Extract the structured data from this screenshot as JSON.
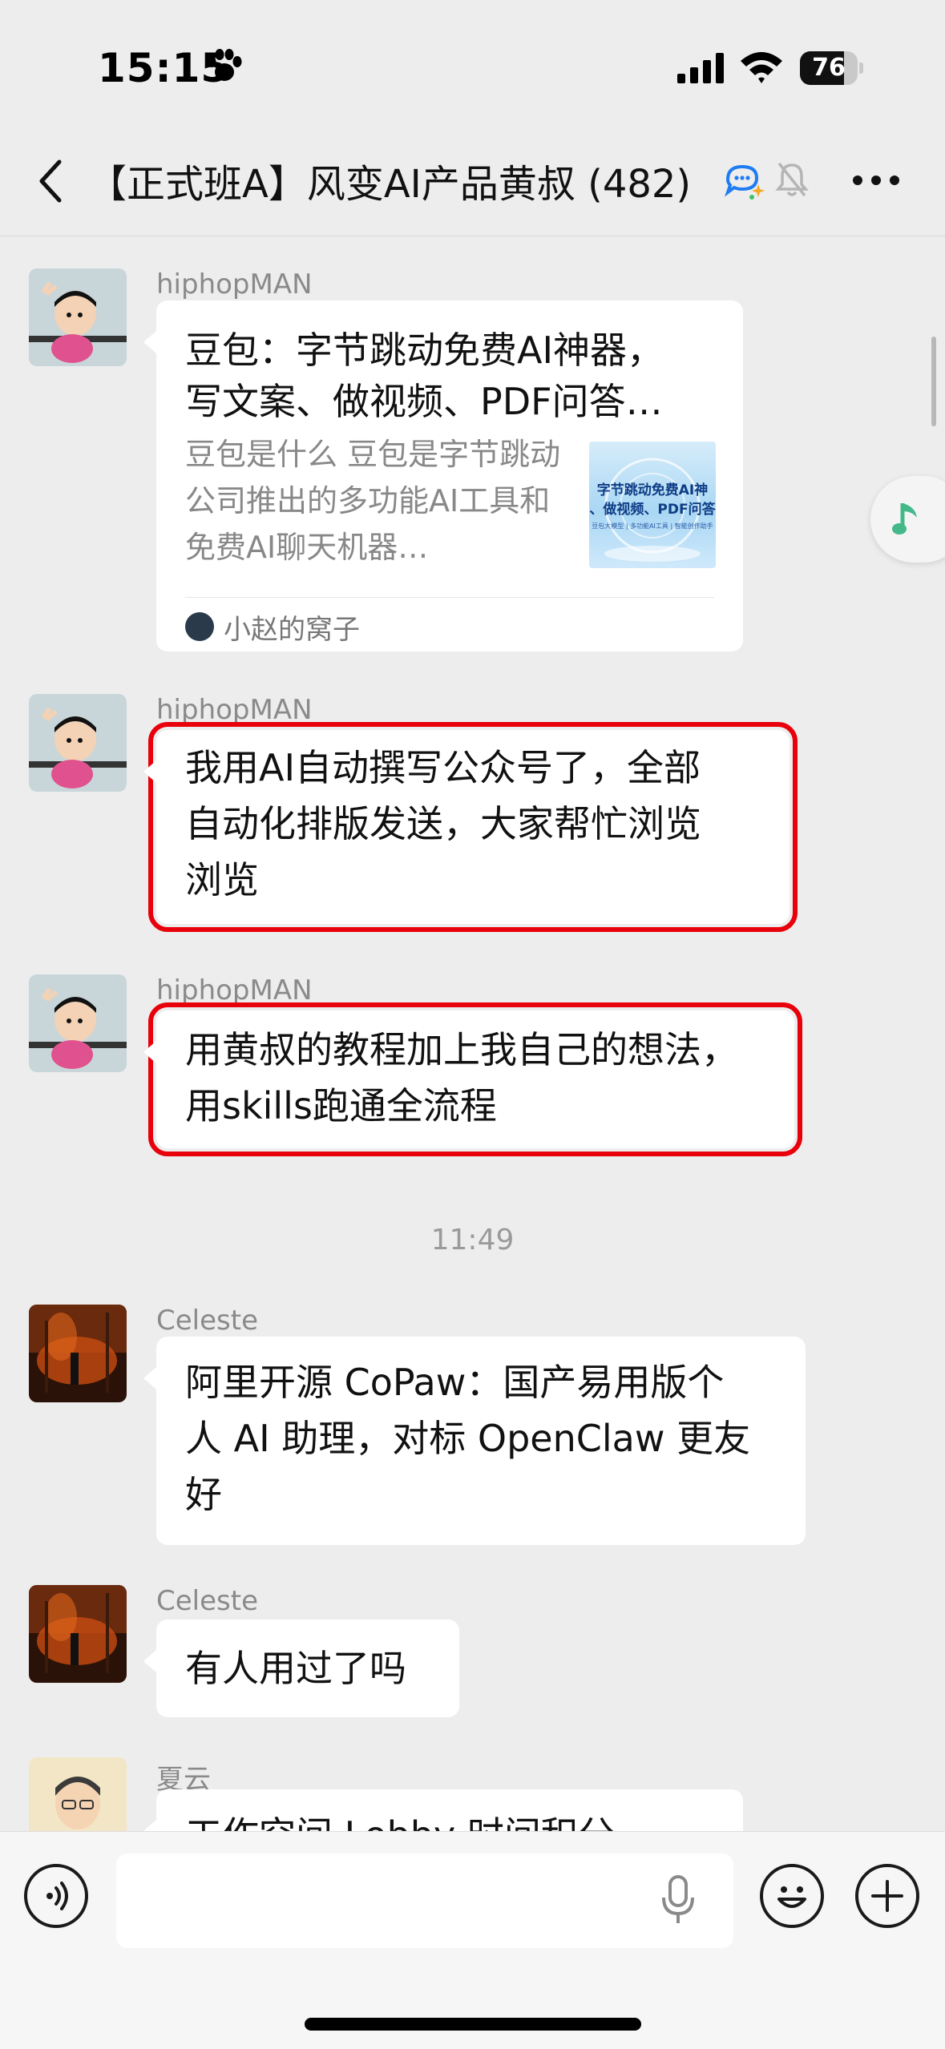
{
  "status_bar": {
    "time": "15:15",
    "battery": "76",
    "battery_level": 0.76
  },
  "nav": {
    "title": "【正式班A】风变AI产品黄叔 (482)"
  },
  "messages": [
    {
      "sender": "hiphopMAN",
      "card": {
        "title": "豆包：字节跳动免费AI神器，写文案、做视频、PDF问答…",
        "desc": "豆包是什么 豆包是字节跳动公司推出的多功能AI工具和免费AI聊天机器…",
        "thumb_lines": [
          "字节跳动免费AI神",
          "、做视频、PDF问答",
          "豆包大模型 | 多功能AI工具 | 智能创作助手"
        ],
        "source": "小赵的窝子"
      }
    },
    {
      "sender": "hiphopMAN",
      "lines": [
        "我用AI自动撰写公众号了，全部",
        "自动化排版发送，大家帮忙浏览",
        "浏览"
      ]
    },
    {
      "sender": "hiphopMAN",
      "lines": [
        "用黄叔的教程加上我自己的想法，",
        "用skills跑通全流程"
      ]
    },
    {
      "timestamp": "11:49"
    },
    {
      "sender": "Celeste",
      "lines": [
        "阿里开源 CoPaw：国产易用版个",
        "人 AI 助理，对标 OpenClaw 更友",
        "好"
      ]
    },
    {
      "sender": "Celeste",
      "lines": [
        "有人用过了吗"
      ]
    },
    {
      "sender": "夏云",
      "lines": [
        "工作空间 Lobby 时间积分"
      ]
    }
  ]
}
